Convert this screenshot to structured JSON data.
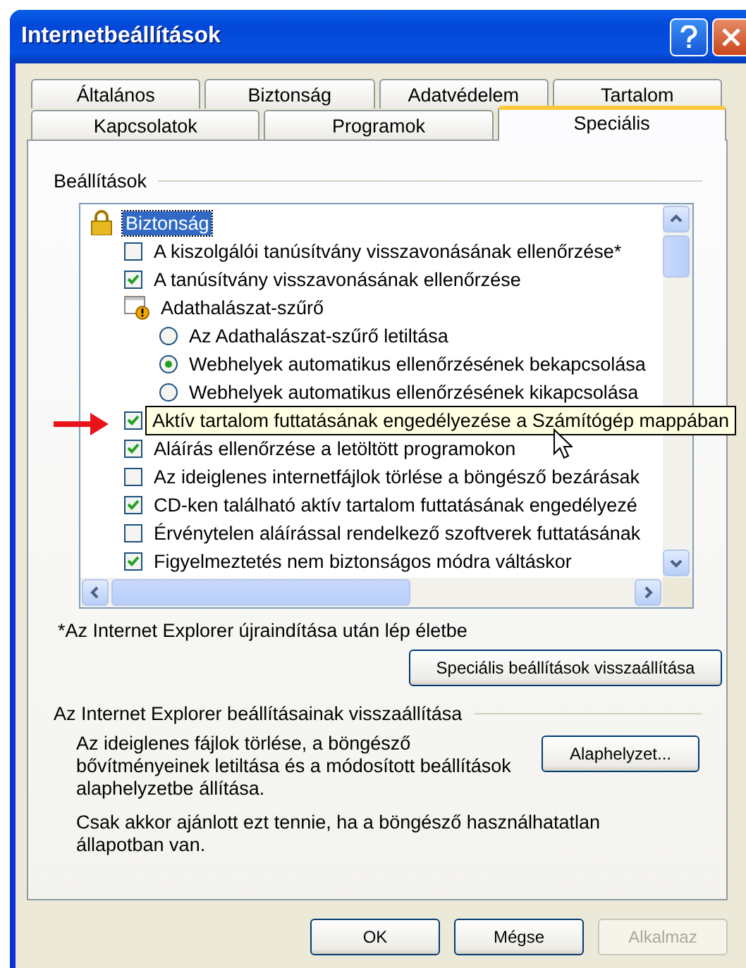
{
  "window": {
    "title": "Internetbeállítások"
  },
  "tab_rows": [
    {
      "tabs": [
        {
          "label": "Általános",
          "selected": false
        },
        {
          "label": "Biztonság",
          "selected": false
        },
        {
          "label": "Adatvédelem",
          "selected": false
        },
        {
          "label": "Tartalom",
          "selected": false
        }
      ]
    },
    {
      "tabs": [
        {
          "label": "Kapcsolatok",
          "selected": false
        },
        {
          "label": "Programok",
          "selected": false
        },
        {
          "label": "Speciális",
          "selected": true
        }
      ]
    }
  ],
  "settings": {
    "label": "Beállítások",
    "items": [
      {
        "kind": "group",
        "label": "Biztonság",
        "selected": true,
        "children": [
          {
            "kind": "checkbox",
            "label": "A kiszolgálói tanúsítvány visszavonásának ellenőrzése*",
            "checked": false,
            "tooltip": false
          },
          {
            "kind": "checkbox",
            "label": "A tanúsítvány visszavonásának ellenőrzése",
            "checked": true,
            "tooltip": false
          },
          {
            "kind": "group",
            "label": "Adathalászat-szűrő",
            "selected": false,
            "children": [
              {
                "kind": "radio",
                "label": "Az Adathalászat-szűrő letiltása",
                "selected": false
              },
              {
                "kind": "radio",
                "label": "Webhelyek automatikus ellenőrzésének bekapcsolása",
                "selected": true
              },
              {
                "kind": "radio",
                "label": "Webhelyek automatikus ellenőrzésének kikapcsolása",
                "selected": false
              }
            ]
          },
          {
            "kind": "checkbox",
            "label": "Aktív tartalom futtatásának engedélyezése a Számítógép mappában",
            "checked": true,
            "tooltip": true
          },
          {
            "kind": "checkbox",
            "label": "Aláírás ellenőrzése a letöltött programokon",
            "checked": true,
            "tooltip": false
          },
          {
            "kind": "checkbox",
            "label": "Az ideiglenes internetfájlok törlése a böngésző bezárásak",
            "checked": false,
            "tooltip": false
          },
          {
            "kind": "checkbox",
            "label": "CD-ken található aktív tartalom futtatásának engedélyezé",
            "checked": true,
            "tooltip": false
          },
          {
            "kind": "checkbox",
            "label": "Érvénytelen aláírással rendelkező szoftverek futtatásának",
            "checked": false,
            "tooltip": false
          },
          {
            "kind": "checkbox",
            "label": "Figyelmeztetés nem biztonságos módra váltáskor",
            "checked": true,
            "tooltip": false
          }
        ]
      }
    ]
  },
  "note": "*Az Internet Explorer újraindítása után lép életbe",
  "restore_button": "Speciális beállítások visszaállítása",
  "reset": {
    "label": "Az Internet Explorer beállításainak visszaállítása",
    "description": "Az ideiglenes fájlok törlése, a böngésző bővítményeinek letiltása és a módosított beállítások alaphelyzetbe állítása.",
    "warning": "Csak akkor ajánlott ezt tennie, ha a böngésző használhatatlan állapotban van.",
    "button": "Alaphelyzet..."
  },
  "buttons": [
    {
      "label": "OK",
      "disabled": false
    },
    {
      "label": "Mégse",
      "disabled": false
    },
    {
      "label": "Alkalmaz",
      "disabled": true
    }
  ]
}
